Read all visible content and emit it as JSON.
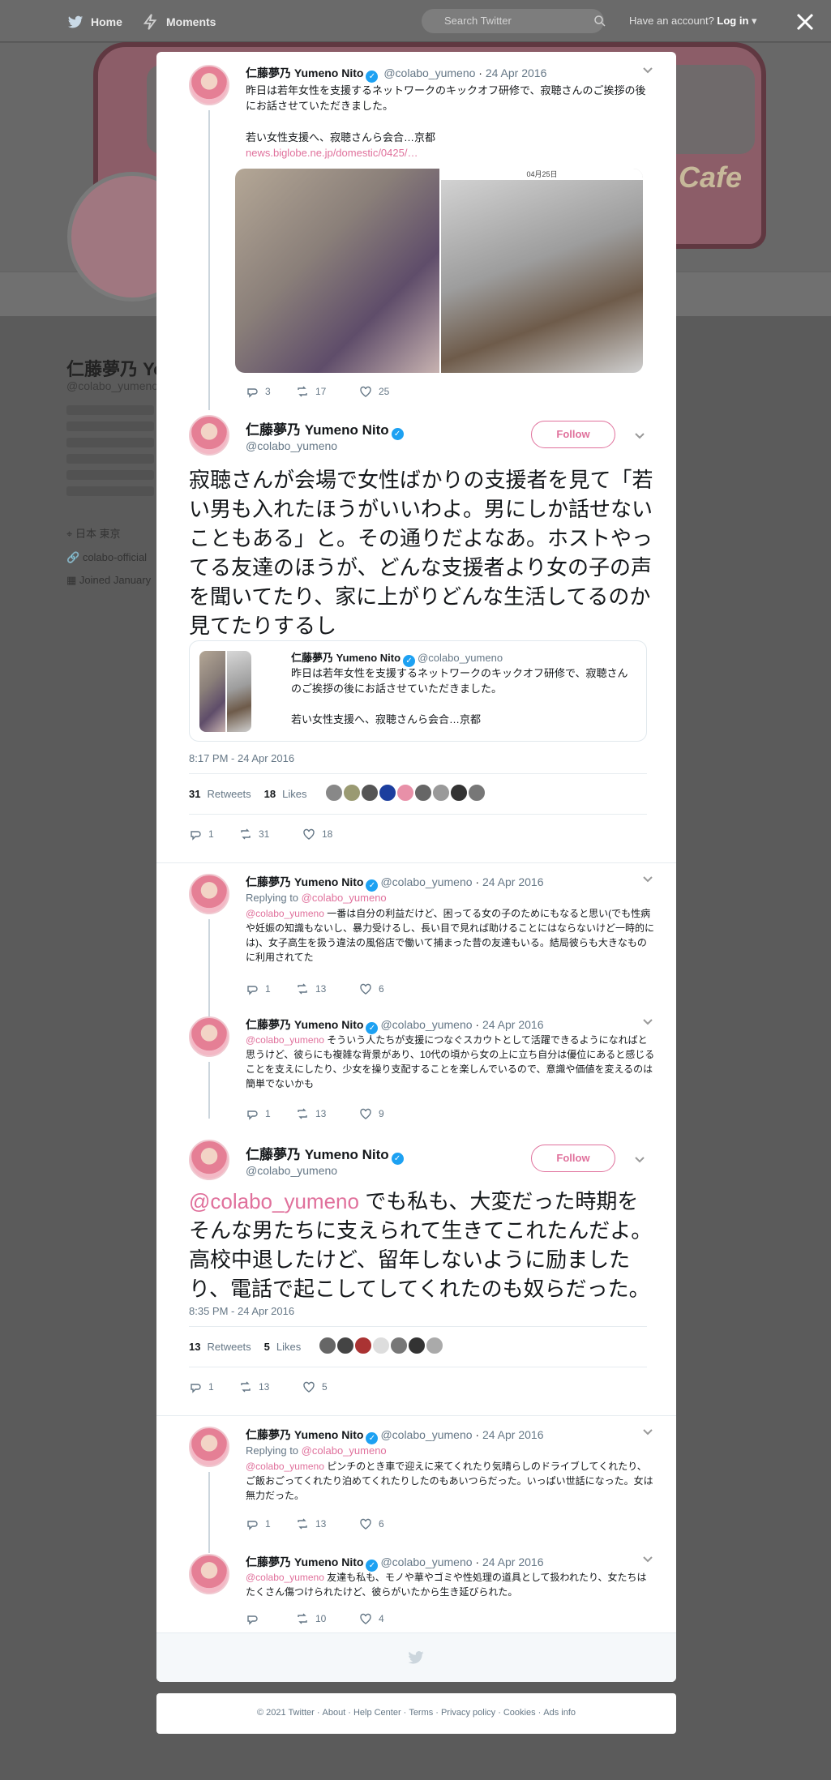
{
  "nav": {
    "home": "Home",
    "moments": "Moments",
    "search_placeholder": "Search Twitter",
    "account": "Have an account?",
    "login": "Log in"
  },
  "background": {
    "name": "仁藤夢乃 Yo",
    "handle": "@colabo_yumeno",
    "location": "日本 東京",
    "link": "colabo-official",
    "joined": "Joined January",
    "cafe": "Cafe"
  },
  "colors": {
    "accent": "#e0719c",
    "verified": "#1da1f2",
    "muted": "#657786"
  },
  "author": {
    "name": "仁藤夢乃 Yumeno Nito",
    "handle": "@colabo_yumeno"
  },
  "tweet1": {
    "date": "24 Apr 2016",
    "text1": "昨日は若年女性を支援するネットワークのキックオフ研修で、寂聴さんのご挨拶の後にお話させていただきました。",
    "text2": "若い女性支援へ、寂聴さんら会合…京都",
    "link": "news.biglobe.ne.jp/domestic/0425/…",
    "replies": "3",
    "retweets": "17",
    "likes": "25",
    "photo_date": "04月25日"
  },
  "main": {
    "follow": "Follow",
    "text": "寂聴さんが会場で女性ばかりの支援者を見て「若い男も入れたほうがいいわよ。男にしか話せないこともある」と。その通りだよなあ。ホストやってる友達のほうが、どんな支援者より女の子の声を聞いてたり、家に上がりどんな生活してるのか見てたりするし",
    "quote_name": "仁藤夢乃 Yumeno Nito",
    "quote_handle": "@colabo_yumeno",
    "quote_text": "昨日は若年女性を支援するネットワークのキックオフ研修で、寂聴さんのご挨拶の後にお話させていただきました。",
    "quote_text2": "若い女性支援へ、寂聴さんら会合…京都",
    "timestamp": "8:17 PM - 24 Apr 2016",
    "retweets": "31",
    "retweets_label": "Retweets",
    "likes": "18",
    "likes_label": "Likes",
    "replies": "1",
    "rt_count": "31",
    "like_count": "18"
  },
  "reply1": {
    "date": "24 Apr 2016",
    "replying": "Replying to",
    "mention": "@colabo_yumeno",
    "text": "一番は自分の利益だけど、困ってる女の子のためにもなると思い(でも性病や妊娠の知識もないし、暴力受けるし、長い目で見れば助けることにはならないけど一時的には)、女子高生を扱う違法の風俗店で働いて捕まった昔の友達もいる。結局彼らも大きなものに利用されてた",
    "replies": "1",
    "retweets": "13",
    "likes": "6"
  },
  "reply2": {
    "date": "24 Apr 2016",
    "mention": "@colabo_yumeno",
    "text": "そういう人たちが支援につなぐスカウトとして活躍できるようになればと思うけど、彼らにも複雑な背景があり、10代の頃から女の上に立ち自分は優位にあると感じることを支えにしたり、少女を操り支配することを楽しんでいるので、意識や価値を変えるのは簡単でないかも",
    "replies": "1",
    "retweets": "13",
    "likes": "9"
  },
  "main2": {
    "follow": "Follow",
    "mention": "@colabo_yumeno",
    "text": "でも私も、大変だった時期をそんな男たちに支えられて生きてこれたんだよ。高校中退したけど、留年しないように励ましたり、電話で起こしてしてくれたのも奴らだった。",
    "timestamp": "8:35 PM - 24 Apr 2016",
    "retweets": "13",
    "retweets_label": "Retweets",
    "likes": "5",
    "likes_label": "Likes",
    "replies": "1",
    "rt_count": "13",
    "like_count": "5"
  },
  "reply3": {
    "date": "24 Apr 2016",
    "replying": "Replying to",
    "mention": "@colabo_yumeno",
    "text": "ピンチのとき車で迎えに来てくれたり気晴らしのドライブしてくれたり、ご飯おごってくれたり泊めてくれたりしたのもあいつらだった。いっぱい世話になった。女は無力だった。",
    "replies": "1",
    "retweets": "13",
    "likes": "6"
  },
  "reply4": {
    "date": "24 Apr 2016",
    "mention": "@colabo_yumeno",
    "text": "友達も私も、モノや華やゴミや性処理の道具として扱われたり、女たちはたくさん傷つけられたけど、彼らがいたから生き延びられた。",
    "retweets": "10",
    "likes": "4"
  },
  "footer": [
    "© 2021 Twitter",
    "About",
    "Help Center",
    "Terms",
    "Privacy policy",
    "Cookies",
    "Ads info"
  ]
}
